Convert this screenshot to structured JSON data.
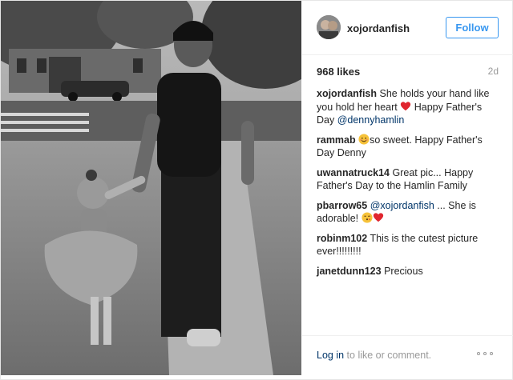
{
  "post": {
    "username": "xojordanfish",
    "follow_label": "Follow",
    "likes": "968 likes",
    "age": "2d"
  },
  "caption": {
    "user": "xojordanfish",
    "text_a": "She holds your hand like you hold her heart",
    "text_b": "Happy Father's Day",
    "mention": "@dennyhamlin"
  },
  "comments": [
    {
      "user": "rammab",
      "text": "so sweet. Happy Father's Day Denny"
    },
    {
      "user": "uwannatruck14",
      "text": "Great pic... Happy Father's Day to the Hamlin Family"
    },
    {
      "user": "pbarrow65",
      "mention": "@xojordanfish",
      "text": "... She is adorable!"
    },
    {
      "user": "robinm102",
      "text": "This is the cutest picture ever!!!!!!!!!"
    },
    {
      "user": "janetdunn123",
      "text": "Precious"
    }
  ],
  "footer": {
    "login_link": "Log in",
    "login_rest": "to like or comment."
  },
  "icons": {
    "heart": "red-heart-icon",
    "smile": "blushing-smile-icon",
    "kiss": "kissing-face-icon",
    "more": "more-options-icon"
  },
  "colors": {
    "accent": "#3897f0",
    "link": "#003569",
    "heart": "#ed4956"
  }
}
